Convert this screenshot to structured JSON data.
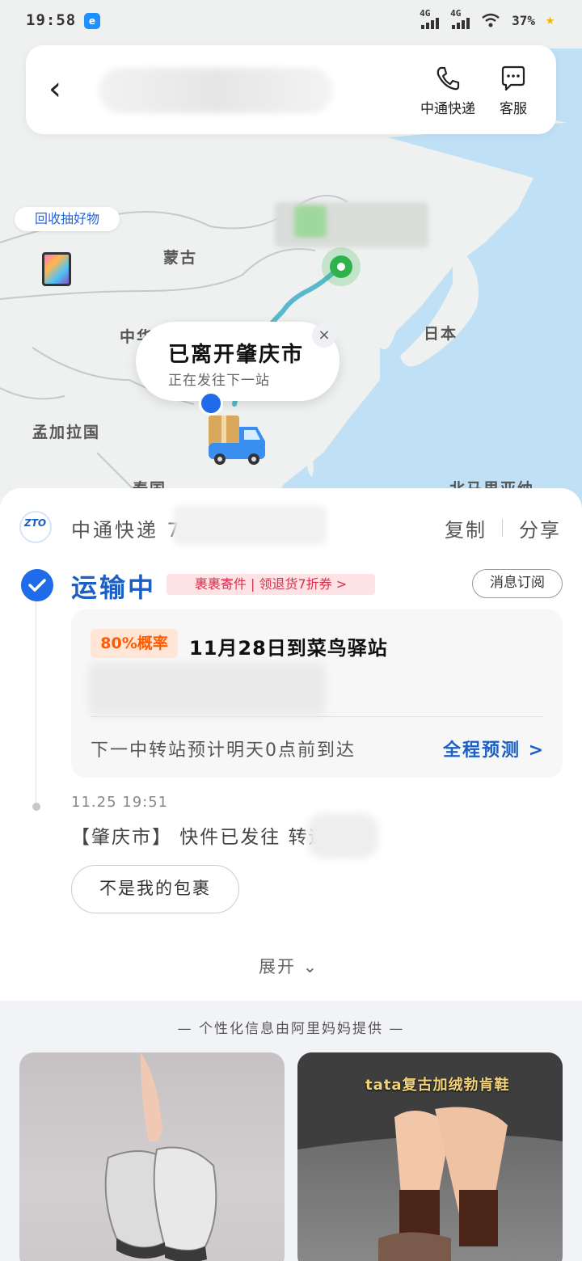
{
  "status_bar": {
    "time": "19:58",
    "app_icon_glyph": "e",
    "network_1": "4G",
    "network_2": "4G",
    "battery": "37%"
  },
  "header": {
    "back_glyph": "‹",
    "courier_action_label": "中通快递",
    "service_action_label": "客服"
  },
  "map": {
    "promo_pill": "回收抽好物",
    "labels": {
      "mongolia": "蒙古",
      "china": "中华",
      "japan": "日本",
      "bangladesh": "孟加拉国",
      "thailand": "泰国",
      "north_mariana": "北马里亚纳"
    },
    "bubble": {
      "title": "已离开肇庆市",
      "subtitle": "正在发往下一站",
      "close_glyph": "×"
    },
    "colors": {
      "route": "#47b3c8",
      "destination": "#2fb24c",
      "sea": "#bfe0f5",
      "land": "#eef1ef"
    }
  },
  "shipment": {
    "courier_logo_text": "ZTO",
    "courier_name": "中通快递 7",
    "copy_label": "复制",
    "share_label": "分享",
    "status_title": "运输中",
    "promo_tag": "裹裹寄件 | 领退货7折券 >",
    "subscribe_label": "消息订阅",
    "prediction": {
      "probability": "80%概率",
      "arrival": "11月28日到菜鸟驿站",
      "next_station": "下一中转站预计明天0点前到达",
      "full_prediction": "全程预测 >"
    },
    "event": {
      "time": "11.25 19:51",
      "text": "【肇庆市】 快件已发往          转运中心"
    },
    "not_mine_label": "不是我的包裹",
    "expand_label": "展开 ⌄"
  },
  "recommend": {
    "title": "— 个性化信息由阿里妈妈提供 —",
    "card2_caption": "tata复古加绒勃肯鞋"
  }
}
